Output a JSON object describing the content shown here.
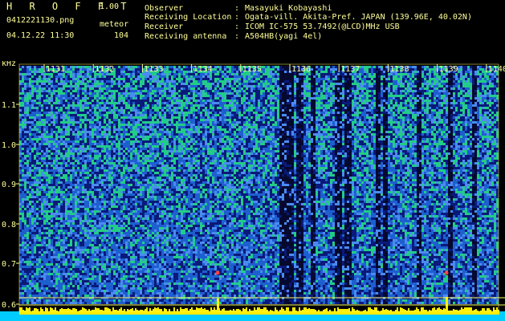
{
  "app": {
    "title": "H R O F F T",
    "version": "1.00"
  },
  "file": {
    "name": "0412221130.png",
    "mode": "meteor",
    "datetime": "04.12.22 11:30",
    "count": "104"
  },
  "info": [
    {
      "label": "Observer",
      "value": "Masayuki Kobayashi"
    },
    {
      "label": "Receiving Location",
      "value": "Ogata-vill. Akita-Pref. JAPAN (139.96E, 40.02N)"
    },
    {
      "label": "Receiver",
      "value": "ICOM IC-575 53.7492(@LCD)MHz USB"
    },
    {
      "label": "Receiving antenna",
      "value": "A504HB(yagi 4el)"
    }
  ],
  "separator": ":",
  "colors": {
    "text": "#ffff99",
    "background": "#000000",
    "noise_low": "#0a1a7a",
    "noise_mid": "#1e5fd0",
    "noise_high": "#22cc88",
    "signal": "#ff4040",
    "baseline": "#ffff00",
    "bottom_band": "#00ccff"
  },
  "chart_data": {
    "type": "heatmap",
    "y_unit": "kHz",
    "y_ticks": [
      "1.1",
      "1.0",
      "0.9",
      "0.8",
      "0.7",
      "0.6"
    ],
    "x_ticks": [
      "1131",
      "1132",
      "1133",
      "1134",
      "1135",
      "1136",
      "1137",
      "1138",
      "1139",
      "1140"
    ],
    "grid": false
  }
}
